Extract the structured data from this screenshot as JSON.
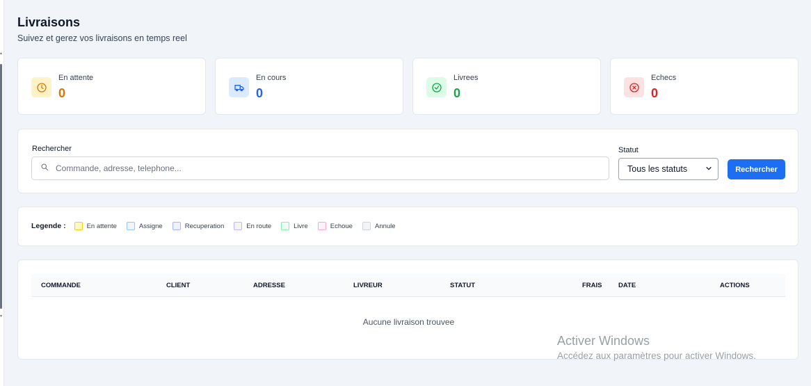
{
  "header": {
    "title": "Livraisons",
    "subtitle": "Suivez et gerez vos livraisons en temps reel"
  },
  "stats": [
    {
      "label": "En attente",
      "value": "0",
      "icon": "clock-icon",
      "color": "#d97706",
      "bg": "#fef3c7"
    },
    {
      "label": "En cours",
      "value": "0",
      "icon": "truck-icon",
      "color": "#2563eb",
      "bg": "#dbeafe"
    },
    {
      "label": "Livrees",
      "value": "0",
      "icon": "check-circle-icon",
      "color": "#16a34a",
      "bg": "#dcfce7"
    },
    {
      "label": "Echecs",
      "value": "0",
      "icon": "x-circle-icon",
      "color": "#dc2626",
      "bg": "#fee2e2"
    }
  ],
  "filters": {
    "search_label": "Rechercher",
    "search_placeholder": "Commande, adresse, telephone...",
    "search_icon": "search-icon",
    "status_label": "Statut",
    "status_value": "Tous les statuts",
    "search_button": "Rechercher",
    "accent": "#1d6ef1"
  },
  "legend": {
    "title": "Legende :",
    "items": [
      {
        "label": "En attente",
        "bg": "#fef9c3",
        "border": "#facc15"
      },
      {
        "label": "Assigne",
        "bg": "#eff6ff",
        "border": "#93c5fd"
      },
      {
        "label": "Recuperation",
        "bg": "#eef2ff",
        "border": "#a5b4fc"
      },
      {
        "label": "En route",
        "bg": "#f3f4f6",
        "border": "#c4b5fd"
      },
      {
        "label": "Livre",
        "bg": "#ecfdf5",
        "border": "#86efac"
      },
      {
        "label": "Echoue",
        "bg": "#fdf2f8",
        "border": "#f9a8d4"
      },
      {
        "label": "Annule",
        "bg": "#f3f4f6",
        "border": "#d1d5db"
      }
    ]
  },
  "table": {
    "columns": [
      "COMMANDE",
      "CLIENT",
      "ADRESSE",
      "LIVREUR",
      "STATUT",
      "FRAIS",
      "DATE",
      "ACTIONS"
    ],
    "empty_message": "Aucune livraison trouvee"
  },
  "watermark": {
    "title": "Activer Windows",
    "subtitle": "Accédez aux paramètres pour activer Windows."
  }
}
